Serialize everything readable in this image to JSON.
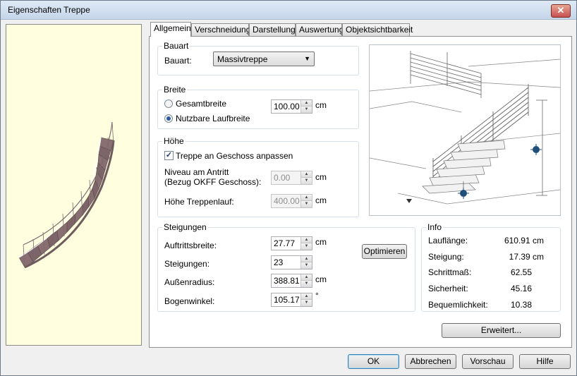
{
  "window": {
    "title": "Eigenschaften Treppe"
  },
  "icons": {
    "close": "close-icon",
    "dropdown": "chevron-down-icon",
    "spin_up": "arrow-up-icon",
    "spin_down": "arrow-down-icon",
    "check": "checkmark-icon"
  },
  "tabs": [
    {
      "label": "Allgemein"
    },
    {
      "label": "Verschneidung"
    },
    {
      "label": "Darstellung"
    },
    {
      "label": "Auswertung"
    },
    {
      "label": "Objektsichtbarkeit"
    }
  ],
  "bauart": {
    "group": "Bauart",
    "label": "Bauart:",
    "value": "Massivtreppe"
  },
  "breite": {
    "group": "Breite",
    "option1": "Gesamtbreite",
    "option2": "Nutzbare Laufbreite",
    "value": "100.00",
    "unit": "cm"
  },
  "hoehe": {
    "group": "Höhe",
    "checkbox": "Treppe an Geschoss anpassen",
    "niveau_label1": "Niveau am Antritt",
    "niveau_label2": "(Bezug OKFF Geschoss):",
    "niveau_value": "0.00",
    "niveau_unit": "cm",
    "hoehe_label": "Höhe Treppenlauf:",
    "hoehe_value": "400.00",
    "hoehe_unit": "cm"
  },
  "steigungen": {
    "group": "Steigungen",
    "auftritt_label": "Auftrittsbreite:",
    "auftritt_value": "27.77",
    "auftritt_unit": "cm",
    "anzahl_label": "Steigungen:",
    "anzahl_value": "23",
    "radius_label": "Außenradius:",
    "radius_value": "388.81",
    "radius_unit": "cm",
    "winkel_label": "Bogenwinkel:",
    "winkel_value": "105.17",
    "winkel_unit": "°",
    "optimize_button": "Optimieren"
  },
  "info": {
    "group": "Info",
    "rows": [
      {
        "label": "Lauflänge:",
        "value": "610.91 cm"
      },
      {
        "label": "Steigung:",
        "value": "17.39 cm"
      },
      {
        "label": "Schrittmaß:",
        "value": "62.55"
      },
      {
        "label": "Sicherheit:",
        "value": "45.16"
      },
      {
        "label": "Bequemlichkeit:",
        "value": "10.38"
      }
    ]
  },
  "buttons": {
    "extended": "Erweitert...",
    "ok": "OK",
    "cancel": "Abbrechen",
    "preview": "Vorschau",
    "help": "Hilfe"
  },
  "colors": {
    "preview_bg": "#ffffe0",
    "stair_tread": "#8a6f72",
    "marker": "#1f4e79"
  }
}
